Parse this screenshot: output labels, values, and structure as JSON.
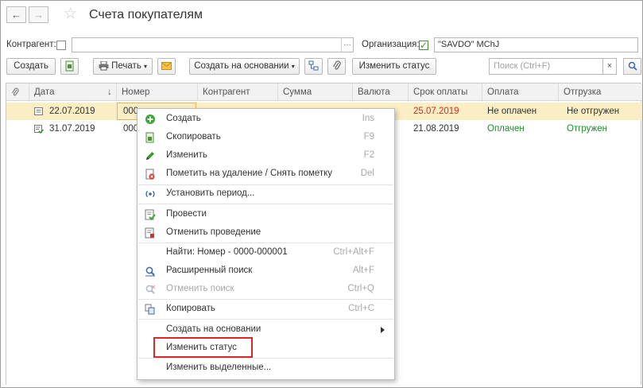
{
  "window": {
    "title": "Счета покупателям"
  },
  "nav": {
    "back": "←",
    "forward": "→"
  },
  "filters": {
    "counterparty_label": "Контрагент:",
    "counterparty_value": "",
    "organization_label": "Организация:",
    "organization_value": "\"SAVDO\" MChJ"
  },
  "toolbar": {
    "create": "Создать",
    "print": "Печать",
    "create_based_on": "Создать на основании",
    "change_status": "Изменить статус",
    "search_placeholder": "Поиск (Ctrl+F)",
    "search_clear": "×"
  },
  "table": {
    "columns": [
      "Дата",
      "Номер",
      "Контрагент",
      "Сумма",
      "Валюта",
      "Срок оплаты",
      "Оплата",
      "Отгрузка"
    ],
    "sort_indicator": "↓",
    "rows": [
      {
        "date": "22.07.2019",
        "number": "000",
        "due": "25.07.2019",
        "payment": "Не оплачен",
        "shipment": "Не отгружен",
        "selected": true
      },
      {
        "date": "31.07.2019",
        "number": "000",
        "due": "21.08.2019",
        "payment": "Оплачен",
        "shipment": "Отгружен",
        "selected": false
      }
    ]
  },
  "context_menu": {
    "items": [
      {
        "label": "Создать",
        "shortcut": "Ins",
        "icon": "add-icon"
      },
      {
        "label": "Скопировать",
        "shortcut": "F9",
        "icon": "copy-doc-icon"
      },
      {
        "label": "Изменить",
        "shortcut": "F2",
        "icon": "pencil-icon"
      },
      {
        "label": "Пометить на удаление / Снять пометку",
        "shortcut": "Del",
        "icon": "delete-mark-icon"
      },
      {
        "label": "Установить период...",
        "shortcut": "",
        "icon": "period-icon"
      },
      {
        "label": "Провести",
        "shortcut": "",
        "icon": "post-icon"
      },
      {
        "label": "Отменить проведение",
        "shortcut": "",
        "icon": "unpost-icon"
      },
      {
        "label": "Найти: Номер - 0000-000001",
        "shortcut": "Ctrl+Alt+F",
        "icon": ""
      },
      {
        "label": "Расширенный поиск",
        "shortcut": "Alt+F",
        "icon": "advanced-search-icon"
      },
      {
        "label": "Отменить поиск",
        "shortcut": "Ctrl+Q",
        "icon": "cancel-search-icon"
      },
      {
        "label": "Копировать",
        "shortcut": "Ctrl+C",
        "icon": "copy-icon"
      },
      {
        "label": "Создать на основании",
        "shortcut": "",
        "icon": ""
      },
      {
        "label": "Изменить статус",
        "shortcut": "",
        "icon": ""
      },
      {
        "label": "Изменить выделенные...",
        "shortcut": "",
        "icon": ""
      }
    ]
  },
  "colors": {
    "selected_row": "#fbeec4",
    "overdue": "#d22d1f",
    "paid": "#1e8a2a",
    "highlight_box": "#e0262b"
  }
}
